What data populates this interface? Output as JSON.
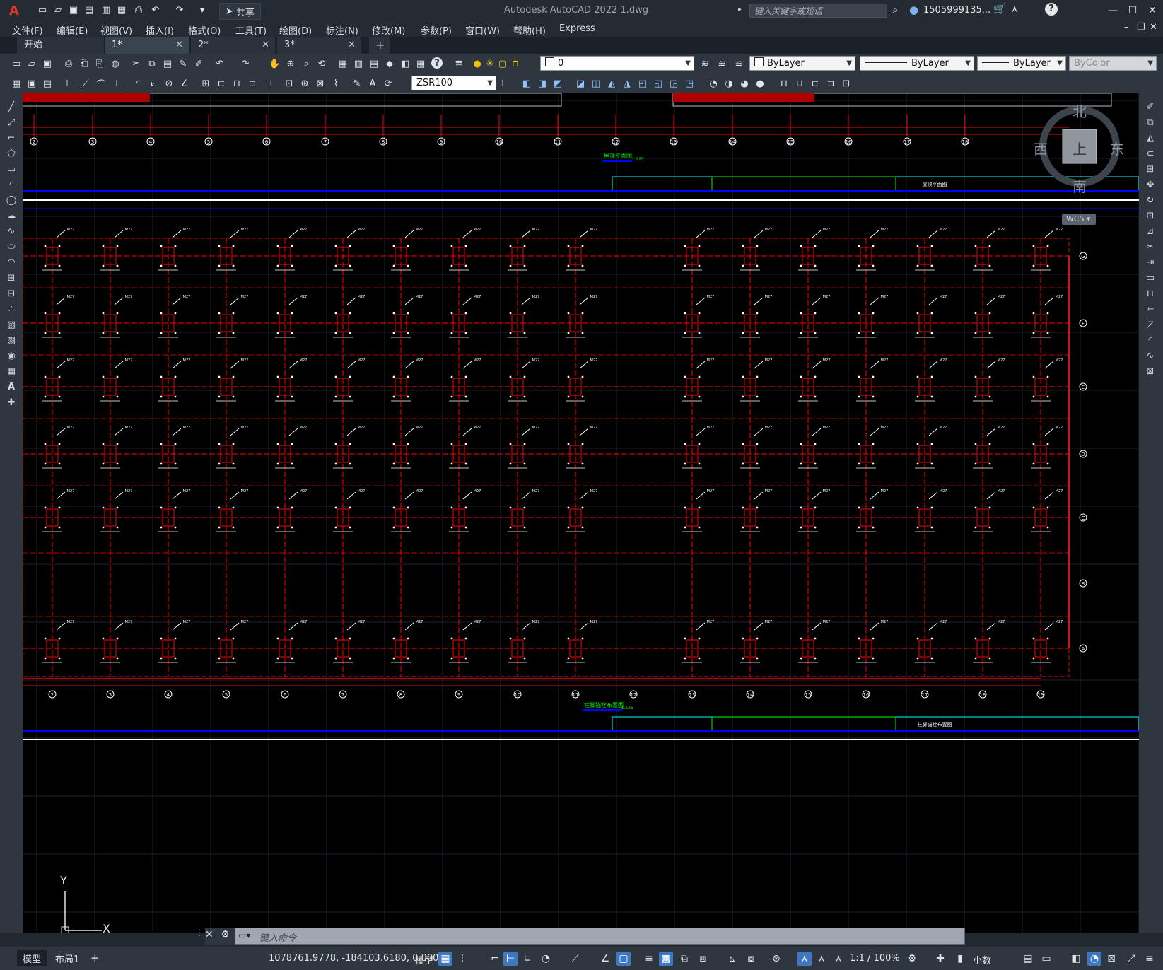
{
  "app": {
    "title": "Autodesk AutoCAD 2022    1.dwg",
    "logo_letter": "A",
    "share_label": "共享",
    "search_placeholder": "键入关键字或短语",
    "user": "1505999135..."
  },
  "menu": [
    "文件(F)",
    "编辑(E)",
    "视图(V)",
    "插入(I)",
    "格式(O)",
    "工具(T)",
    "绘图(D)",
    "标注(N)",
    "修改(M)",
    "参数(P)",
    "窗口(W)",
    "帮助(H)",
    "Express"
  ],
  "tabs": [
    {
      "label": "开始",
      "active": false,
      "closable": false
    },
    {
      "label": "1*",
      "active": true,
      "closable": true
    },
    {
      "label": "2*",
      "active": false,
      "closable": true
    },
    {
      "label": "3*",
      "active": false,
      "closable": true
    }
  ],
  "toolbar": {
    "layer_value": "0",
    "color_value": "ByLayer",
    "linetype_value": "ByLayer",
    "lineweight_value": "ByLayer",
    "plotstyle_value": "ByColor",
    "dimstyle_value": "ZSR100"
  },
  "viewcube": {
    "north": "北",
    "south": "南",
    "east": "东",
    "west": "西",
    "top": "上",
    "wcs": "WCS"
  },
  "ucs": {
    "x": "X",
    "y": "Y"
  },
  "drawing": {
    "top_grid_labels": [
      "2",
      "3",
      "4",
      "5",
      "6",
      "7",
      "8",
      "9",
      "10",
      "11",
      "12",
      "13",
      "14",
      "15",
      "16",
      "17",
      "18"
    ],
    "bottom_grid_labels": [
      "2",
      "3",
      "4",
      "5",
      "6",
      "7",
      "8",
      "9",
      "10",
      "11",
      "12",
      "13",
      "14",
      "15",
      "16",
      "17",
      "18",
      "19"
    ],
    "row_labels": [
      "G",
      "F",
      "E",
      "D",
      "C",
      "B",
      "A"
    ],
    "title_upper": "屋顶平面图",
    "title_lower": "柱脚锚栓布置图",
    "scale_text": "1:125",
    "title_block_upper": "屋顶平面图",
    "title_block_lower": "柱脚锚栓布置图"
  },
  "command": {
    "placeholder": "键入命令"
  },
  "status": {
    "layout_tabs": [
      "模型",
      "布局1"
    ],
    "coordinates": "1078761.9778, -184103.6180, 0.0000",
    "space": "模型",
    "scale": "1:1 / 100%",
    "units": "小数"
  },
  "colors": {
    "accent": "#3f78c0",
    "canvas_bg": "#000000",
    "drawing_red": "#ff0000",
    "drawing_green": "#00ff00",
    "drawing_blue": "#0000ff",
    "drawing_cyan": "#00ffff"
  }
}
